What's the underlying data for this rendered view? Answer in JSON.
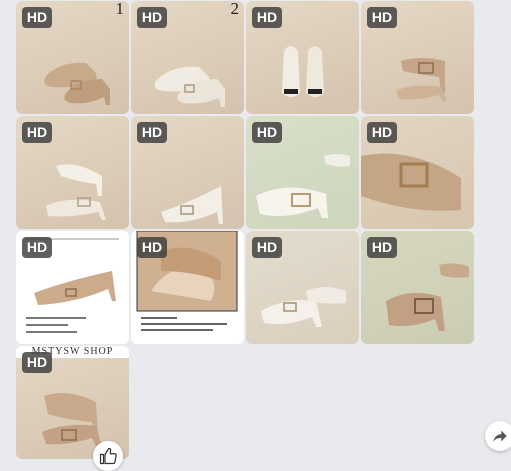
{
  "badge_label": "HD",
  "tiles": [
    {
      "num": "1"
    },
    {
      "num": "2"
    },
    {},
    {},
    {},
    {},
    {},
    {},
    {},
    {},
    {},
    {},
    {
      "shop_text": "MSTYSW SHOP"
    }
  ],
  "icons": {
    "like": "thumbs-up-icon",
    "share": "share-arrow-icon"
  },
  "colors": {
    "background": "#e9eaee",
    "badge_bg": "#3c3c3c",
    "shoe_beige": "#c8a98a",
    "shoe_white": "#f3eee6"
  }
}
